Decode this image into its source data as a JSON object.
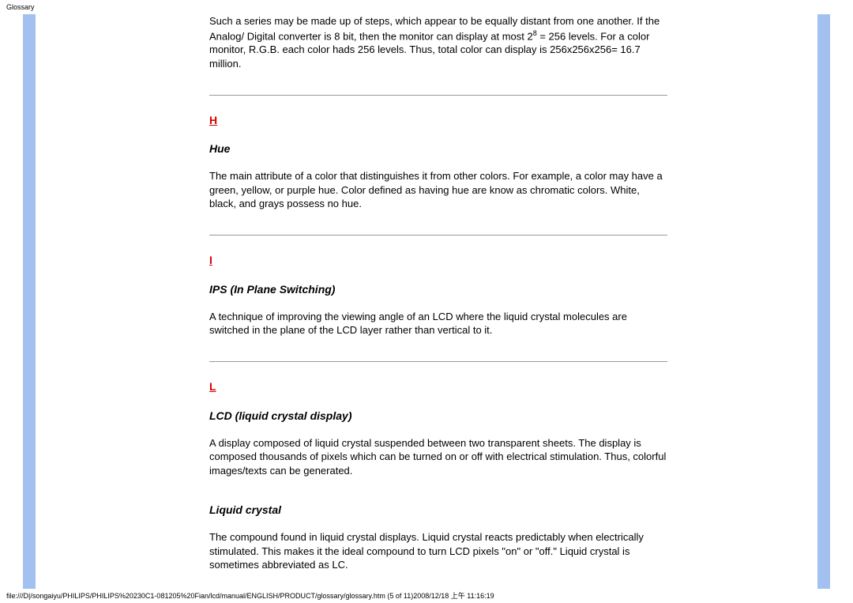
{
  "pageLabel": "Glossary",
  "intro": {
    "line1_a": "Such a series may be made up of steps, which appear to be equally distant from one another. If the Analog/ Digital converter is 8 bit, then the monitor can display at most 2",
    "exp": "8",
    "line1_b": " = 256 levels. For a color monitor, R.G.B. each color hads 256 levels. Thus, total color can display is 256x256x256= 16.7 million."
  },
  "sections": [
    {
      "letter": "H",
      "entries": [
        {
          "term": "Hue",
          "def": "The main attribute of a color that distinguishes it from other colors. For example, a color may have a green, yellow, or purple hue. Color defined as having hue are know as chromatic colors. White, black, and grays possess no hue."
        }
      ]
    },
    {
      "letter": "I",
      "entries": [
        {
          "term": "IPS (In Plane Switching)",
          "def": "A technique of improving the viewing angle of an LCD where the liquid crystal molecules are switched in the plane of the LCD layer rather than vertical to it."
        }
      ]
    },
    {
      "letter": "L",
      "entries": [
        {
          "term": "LCD (liquid crystal display)",
          "def": "A display composed of liquid crystal suspended between two transparent sheets. The display is composed thousands of pixels which can be turned on or off with electrical stimulation. Thus, colorful images/texts can be generated."
        },
        {
          "term": "Liquid crystal",
          "def": "The compound found in liquid crystal displays. Liquid crystal reacts predictably when electrically stimulated. This makes it the ideal compound to turn LCD pixels \"on\" or \"off.\" Liquid crystal is sometimes abbreviated as LC."
        }
      ]
    }
  ],
  "footerPath": "file:///D|/songaiyu/PHILIPS/PHILIPS%20230C1-081205%20Fian/lcd/manual/ENGLISH/PRODUCT/glossary/glossary.htm (5 of 11)2008/12/18 上午 11:16:19"
}
